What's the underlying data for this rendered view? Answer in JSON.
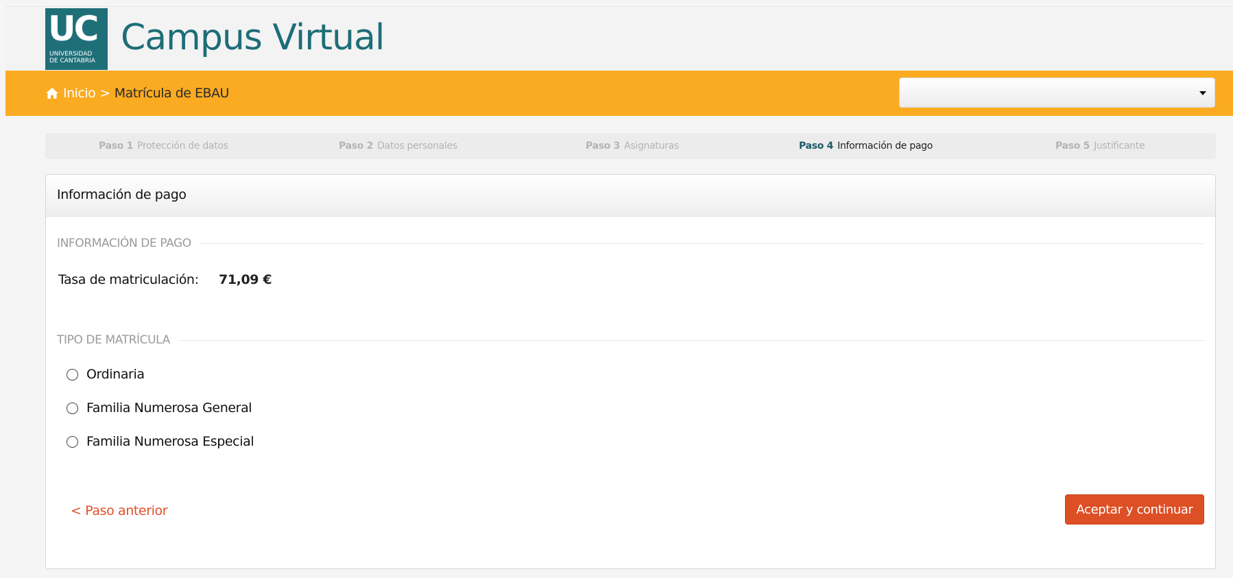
{
  "header": {
    "logo": {
      "text": "UC",
      "subline1": "UNIVERSIDAD",
      "subline2": "DE CANTABRIA"
    },
    "site_title": "Campus Virtual"
  },
  "navbar": {
    "breadcrumb": {
      "home": "Inicio",
      "separator": ">",
      "current": "Matrícula de EBAU"
    },
    "select_value": ""
  },
  "steps": [
    {
      "num": "Paso 1",
      "label": "Protección de datos",
      "active": false
    },
    {
      "num": "Paso 2",
      "label": "Datos personales",
      "active": false
    },
    {
      "num": "Paso 3",
      "label": "Asignaturas",
      "active": false
    },
    {
      "num": "Paso 4",
      "label": "Información de pago",
      "active": true
    },
    {
      "num": "Paso 5",
      "label": "Justificante",
      "active": false
    }
  ],
  "panel": {
    "title": "Información de pago",
    "payment_section": "INFORMACIÓN DE PAGO",
    "fee_label": "Tasa de matriculación:",
    "fee_value": "71,09 €",
    "type_section": "TIPO DE MATRÍCULA",
    "options": [
      "Ordinaria",
      "Familia Numerosa General",
      "Familia Numerosa Especial"
    ],
    "prev_label": "< Paso anterior",
    "continue_label": "Aceptar y continuar"
  },
  "colors": {
    "brand_teal": "#1f6f79",
    "nav_orange": "#fbab21",
    "action_red": "#dd4f25"
  }
}
